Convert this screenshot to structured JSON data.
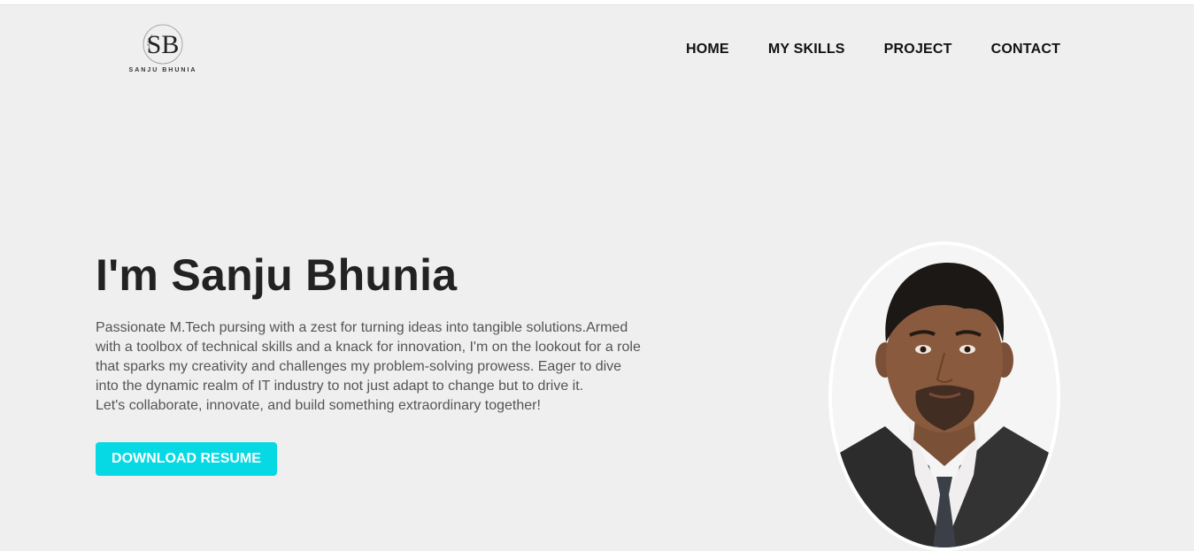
{
  "header": {
    "logo_text": "SANJU BHUNIA",
    "logo_monogram": "SB",
    "nav": [
      {
        "label": "HOME"
      },
      {
        "label": "MY SKILLS"
      },
      {
        "label": "PROJECT"
      },
      {
        "label": "CONTACT"
      }
    ]
  },
  "hero": {
    "title": "I'm Sanju Bhunia",
    "bio_lines": [
      "Passionate M.Tech pursing with a zest for turning ideas into tangible solutions.Armed",
      "with a toolbox of technical skills and a knack for innovation, I'm on the lookout for a role",
      "that sparks my creativity and challenges my problem-solving prowess. Eager to dive",
      "into the dynamic realm of IT industry to not just adapt to change but to drive it.",
      "Let's collaborate, innovate, and build something extraordinary together!"
    ],
    "button_label": "DOWNLOAD RESUME"
  },
  "colors": {
    "background": "#efefef",
    "accent": "#06d9e4",
    "text_dark": "#222222",
    "text_body": "#555555"
  },
  "icons": {
    "logo": "sb-monogram-logo",
    "profile": "profile-photo"
  }
}
